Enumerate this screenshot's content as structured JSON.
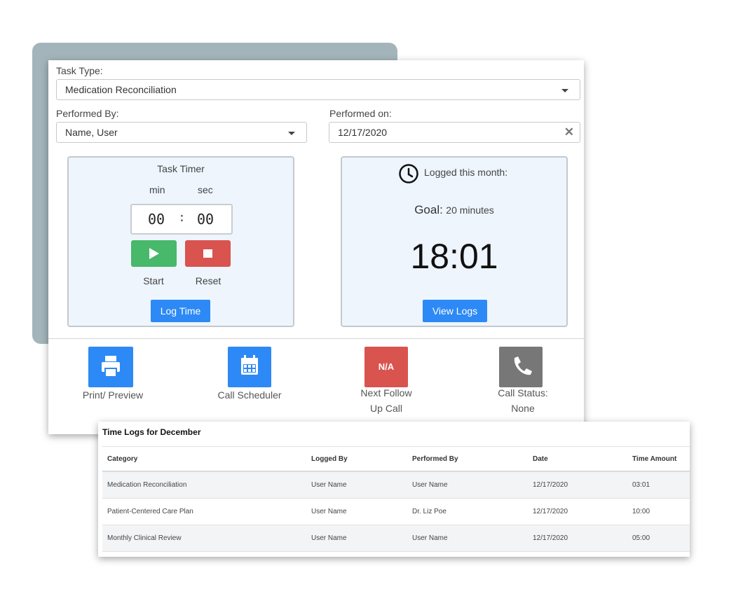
{
  "form": {
    "task_type_label": "Task Type:",
    "task_type_value": "Medication Reconciliation",
    "performed_by_label": "Performed By:",
    "performed_by_value": "Name, User",
    "performed_on_label": "Performed on:",
    "performed_on_value": "12/17/2020"
  },
  "timer": {
    "title": "Task Timer",
    "min_label": "min",
    "sec_label": "sec",
    "minutes": "00",
    "seconds": "00",
    "colon": ":",
    "start_label": "Start",
    "reset_label": "Reset",
    "log_time_label": "Log Time"
  },
  "logged": {
    "title": "Logged this month:",
    "goal_label": "Goal:",
    "goal_value": "20 minutes",
    "total": "18:01",
    "view_logs_label": "View Logs"
  },
  "actions": [
    {
      "label_line1": "Print/ Preview",
      "label_line2": "",
      "icon": "printer-icon",
      "color": "#2d89f5"
    },
    {
      "label_line1": "Call Scheduler",
      "label_line2": "",
      "icon": "calendar-icon",
      "color": "#2d89f5"
    },
    {
      "label_line1": "Next Follow",
      "label_line2": "Up Call",
      "icon_text": "N/A",
      "color": "#d9534f"
    },
    {
      "label_line1": "Call Status:",
      "label_line2": "None",
      "icon": "phone-icon",
      "color": "#777777"
    }
  ],
  "time_logs": {
    "title": "Time Logs for December",
    "columns": [
      "Category",
      "Logged By",
      "Performed By",
      "Date",
      "Time Amount"
    ],
    "rows": [
      [
        "Medication Reconciliation",
        "User Name",
        "User Name",
        "12/17/2020",
        "03:01"
      ],
      [
        "Patient-Centered Care Plan",
        "User Name",
        "Dr. Liz Poe",
        "12/17/2020",
        "10:00"
      ],
      [
        "Monthly Clinical Review",
        "User Name",
        "User Name",
        "12/17/2020",
        "05:00"
      ]
    ]
  },
  "colors": {
    "start_green": "#48b86a",
    "reset_red": "#d9534f",
    "primary_blue": "#2d89f5",
    "backdrop": "#a3b5ba"
  }
}
